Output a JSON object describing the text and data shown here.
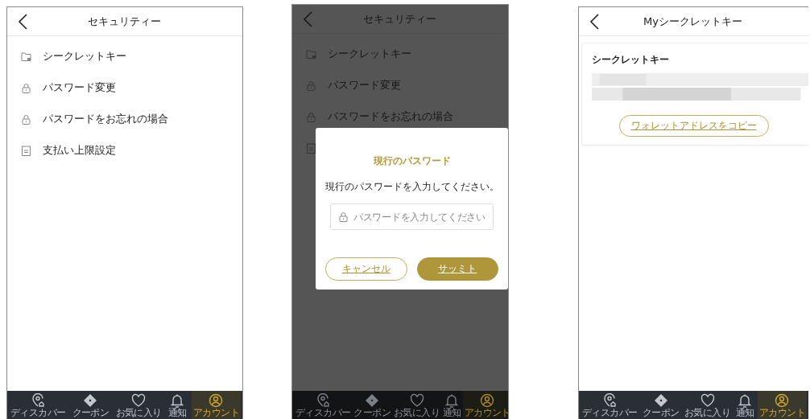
{
  "screens": [
    {
      "kind": "menu",
      "title": "セキュリティー",
      "items": [
        {
          "kind": "folder",
          "label": "シークレットキー"
        },
        {
          "kind": "lock",
          "label": "パスワード変更"
        },
        {
          "kind": "lock",
          "label": "パスワードをお忘れの場合"
        },
        {
          "kind": "document",
          "label": "支払い上限設定"
        }
      ],
      "tabs": [
        {
          "label": "ディスカバー",
          "selected": false
        },
        {
          "label": "クーポン",
          "selected": false
        },
        {
          "label": "お気に入り",
          "selected": false
        },
        {
          "label": "通知",
          "selected": false
        },
        {
          "label": "アカウント",
          "selected": true
        }
      ]
    },
    {
      "kind": "menu",
      "title": "セキュリティー",
      "items": [
        {
          "kind": "folder",
          "label": "シークレットキー"
        },
        {
          "kind": "lock",
          "label": "パスワード変更"
        },
        {
          "kind": "lock",
          "label": "パスワードをお忘れの場合"
        },
        {
          "kind": "document"
        }
      ],
      "dialog": {
        "title": "現行のパスワード",
        "message": "現行のパスワードを入力してください。",
        "field": {
          "placeholder": "パスワードを入力してください"
        },
        "buttons": [
          {
            "kind": "outline",
            "label": "キャンセル"
          },
          {
            "kind": "filled",
            "label": "サッミト"
          }
        ]
      },
      "tabs": [
        {
          "label": "ディスカバー",
          "selected": false
        },
        {
          "label": "クーポン",
          "selected": false
        },
        {
          "label": "お気に入り",
          "selected": false
        },
        {
          "label": "通知",
          "selected": false
        },
        {
          "label": "アカウント",
          "selected": true
        }
      ]
    },
    {
      "kind": "detail",
      "title": "Myシークレットキー",
      "card": {
        "label": "シークレットキー",
        "button": "ワォレットアドレスをコピー"
      },
      "tabs": [
        {
          "label": "ディスカバー",
          "selected": false
        },
        {
          "label": "クーポン",
          "selected": false
        },
        {
          "label": "お気に入り",
          "selected": false
        },
        {
          "label": "通知",
          "selected": false
        },
        {
          "label": "アカウント",
          "selected": true
        }
      ]
    }
  ]
}
